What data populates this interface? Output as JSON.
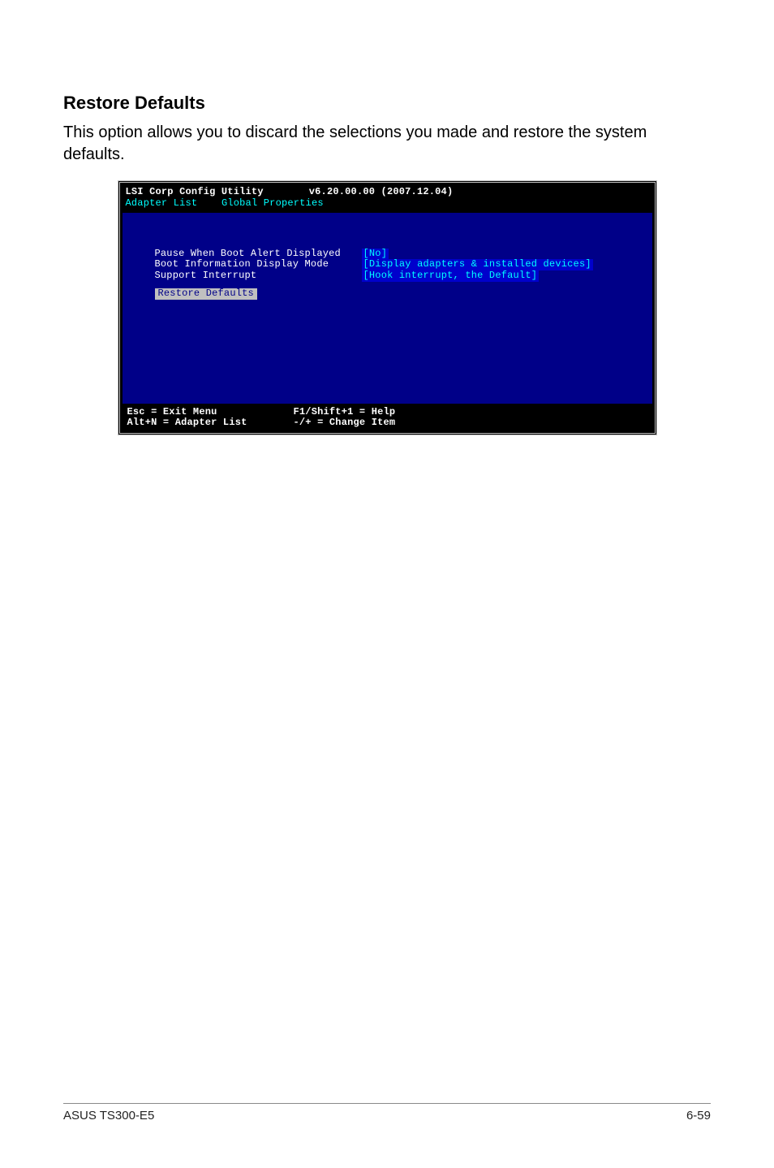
{
  "section": {
    "heading": "Restore Defaults",
    "body": "This option allows you to discard the selections you made and restore the system defaults."
  },
  "bios": {
    "utility_name": "LSI Corp Config Utility",
    "version": "v6.20.00.00 (2007.12.04)",
    "breadcrumb": {
      "root": "Adapter List",
      "current": "Global Properties"
    },
    "props": [
      {
        "label": "Pause When Boot Alert Displayed",
        "value": "[No]"
      },
      {
        "label": "Boot Information Display Mode",
        "value": "[Display adapters & installed devices]"
      },
      {
        "label": "Support Interrupt",
        "value": "[Hook interrupt, the Default]"
      }
    ],
    "restore_label": "Restore Defaults",
    "footer": {
      "esc": "Esc = Exit Menu",
      "help": "F1/Shift+1 = Help",
      "altn": "Alt+N = Adapter List",
      "change": "-/+ = Change Item"
    }
  },
  "page_footer": {
    "left": "ASUS TS300-E5",
    "right": "6-59"
  }
}
